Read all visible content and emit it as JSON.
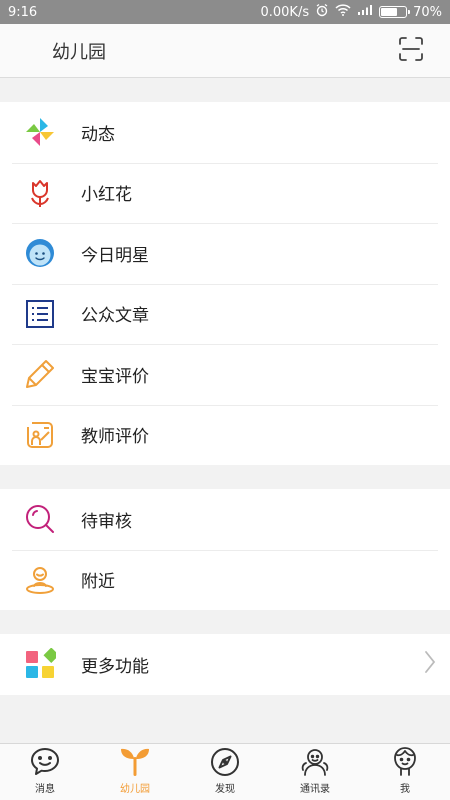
{
  "status_bar": {
    "time": "9:16",
    "network_speed": "0.00K/s",
    "battery": "70%",
    "battery_level": 0.7
  },
  "header": {
    "title": "幼儿园",
    "scan_icon": "scan-icon"
  },
  "groups": [
    {
      "items": [
        {
          "label": "动态",
          "icon": "pinwheel-icon"
        },
        {
          "label": "小红花",
          "icon": "flower-icon"
        },
        {
          "label": "今日明星",
          "icon": "star-face-icon"
        },
        {
          "label": "公众文章",
          "icon": "article-list-icon"
        },
        {
          "label": "宝宝评价",
          "icon": "pencil-icon"
        },
        {
          "label": "教师评价",
          "icon": "teacher-review-icon"
        }
      ]
    },
    {
      "items": [
        {
          "label": "待审核",
          "icon": "search-review-icon"
        },
        {
          "label": "附近",
          "icon": "nearby-person-icon"
        }
      ]
    },
    {
      "items": [
        {
          "label": "更多功能",
          "icon": "more-apps-icon"
        }
      ]
    }
  ],
  "tabs": [
    {
      "label": "消息",
      "icon": "message-icon",
      "active": false
    },
    {
      "label": "幼儿园",
      "icon": "sprout-icon",
      "active": true
    },
    {
      "label": "发现",
      "icon": "compass-icon",
      "active": false
    },
    {
      "label": "通讯录",
      "icon": "contacts-icon",
      "active": false
    },
    {
      "label": "我",
      "icon": "me-icon",
      "active": false
    }
  ],
  "colors": {
    "accent": "#f39c34",
    "status_bar": "#8c8c8c"
  }
}
